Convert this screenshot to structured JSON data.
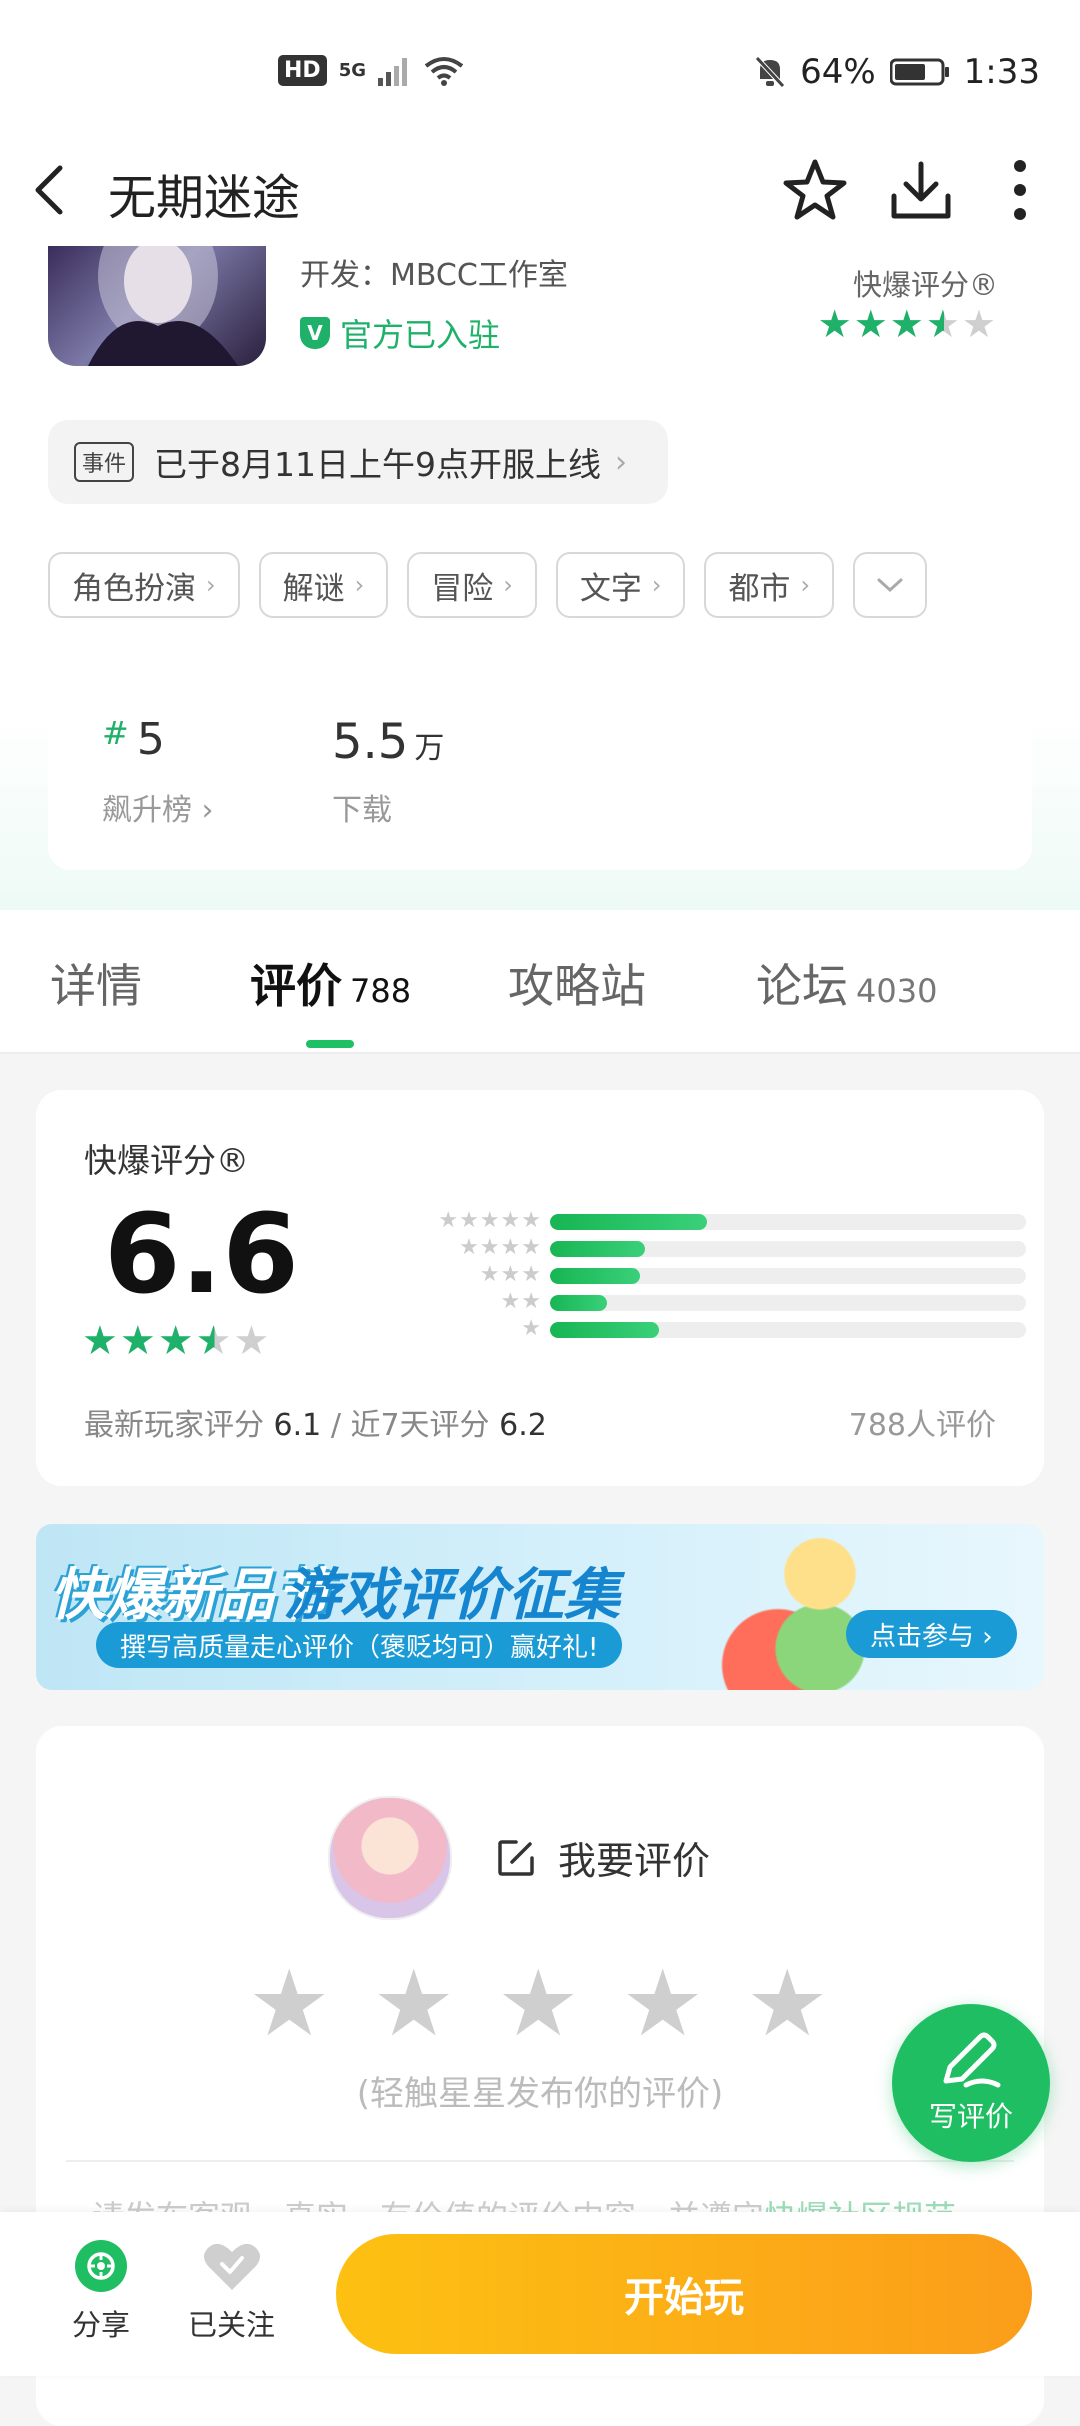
{
  "status_bar": {
    "hd": "HD",
    "network": "5G",
    "battery": "64%",
    "time": "1:33"
  },
  "top_bar": {
    "title": "无期迷途"
  },
  "app": {
    "developer": "开发：MBCC工作室",
    "official": "官方已入驻",
    "official_badge": "V",
    "rating_label": "快爆评分®",
    "rating_stars": 3.5
  },
  "event": {
    "tag": "事件",
    "text": "已于8月11日上午9点开服上线",
    "arrow": "›"
  },
  "tags": [
    {
      "label": "角色扮演",
      "chev": "›"
    },
    {
      "label": "解谜",
      "chev": "›"
    },
    {
      "label": "冒险",
      "chev": "›"
    },
    {
      "label": "文字",
      "chev": "›"
    },
    {
      "label": "都市",
      "chev": "›"
    }
  ],
  "stats": {
    "rank_hash": "#",
    "rank": "5",
    "rank_label": "飙升榜 ›",
    "downloads": "5.5",
    "downloads_unit": "万",
    "downloads_label": "下载"
  },
  "tabs": [
    {
      "label": "详情",
      "count": ""
    },
    {
      "label": "评价",
      "count": "788"
    },
    {
      "label": "攻略站",
      "count": ""
    },
    {
      "label": "论坛",
      "count": "4030"
    }
  ],
  "rating_card": {
    "title": "快爆评分®",
    "score": "6.6",
    "stars": 3.5,
    "distribution": [
      {
        "stars": 5,
        "fraction": 0.33
      },
      {
        "stars": 4,
        "fraction": 0.2
      },
      {
        "stars": 3,
        "fraction": 0.19
      },
      {
        "stars": 2,
        "fraction": 0.12
      },
      {
        "stars": 1,
        "fraction": 0.23
      }
    ],
    "latest_label": "最新玩家评分",
    "latest_value": "6.1",
    "separator": "/",
    "week_label": "近7天评分",
    "week_value": "6.2",
    "count": "788人评价"
  },
  "banner": {
    "title1": "快爆新品节",
    "title2": "游戏评价征集",
    "subtitle": "撰写高质量走心评价（褒贬均可）赢好礼!",
    "button": "点击参与 ›"
  },
  "write_card": {
    "label": "我要评价",
    "hint": "(轻触星星发布你的评价)",
    "note": "请发布客观、真实、有价值的评价内容，并遵守",
    "note_link": "快爆社区规范"
  },
  "fab": {
    "label": "写评价"
  },
  "bottom": {
    "share": "分享",
    "follow": "已关注",
    "play": "开始玩"
  },
  "colors": {
    "accent_green": "#1fbe63",
    "play_orange": "#fb9d1a"
  }
}
